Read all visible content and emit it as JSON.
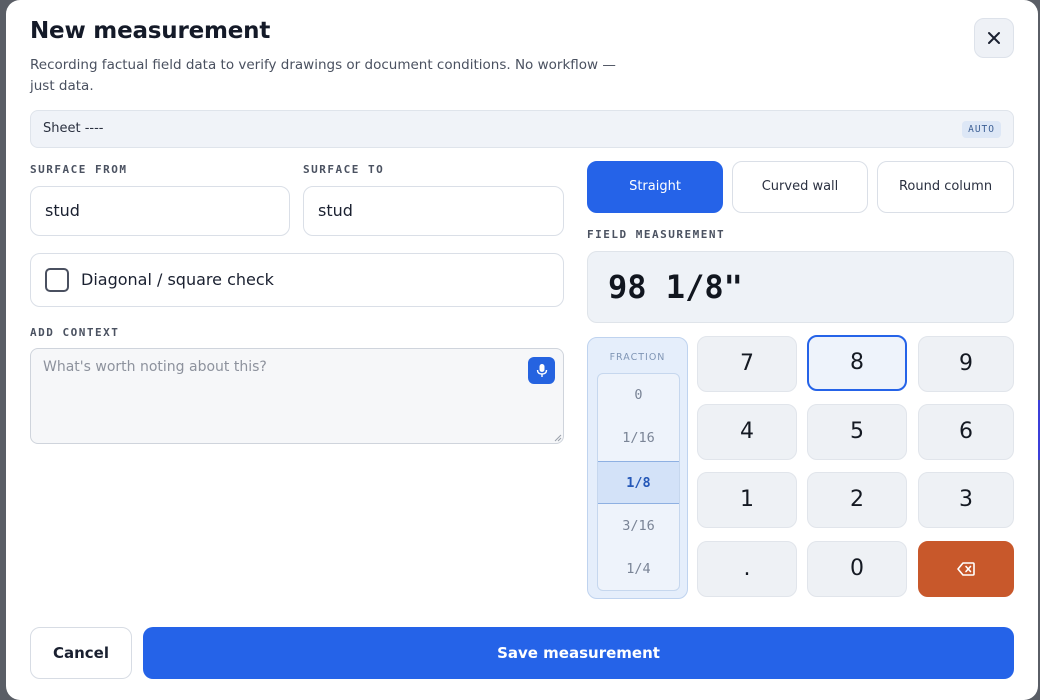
{
  "dialog": {
    "title": "New measurement",
    "subtitle": "Recording factual field data to verify drawings or document conditions. No workflow — just data."
  },
  "sheet": {
    "label": "Sheet ----",
    "badge": "AUTO"
  },
  "surface_from": {
    "label": "SURFACE FROM",
    "value": "stud"
  },
  "surface_to": {
    "label": "SURFACE TO",
    "value": "stud"
  },
  "diagonal_check": {
    "label": "Diagonal / square check",
    "checked": false
  },
  "context": {
    "label": "ADD CONTEXT",
    "placeholder": "What's worth noting about this?"
  },
  "shape_tabs": [
    {
      "label": "Straight",
      "active": true
    },
    {
      "label": "Curved wall",
      "active": false
    },
    {
      "label": "Round column",
      "active": false
    }
  ],
  "measurement": {
    "label": "FIELD MEASUREMENT",
    "value": "98 1/8\""
  },
  "fraction": {
    "title": "FRACTION",
    "options": [
      "0",
      "1/16",
      "1/8",
      "3/16",
      "1/4"
    ],
    "selected": "1/8"
  },
  "keypad": {
    "keys": [
      "7",
      "8",
      "9",
      "4",
      "5",
      "6",
      "1",
      "2",
      "3",
      ".",
      "0"
    ],
    "active_key": "8",
    "backspace_icon": "backspace-icon"
  },
  "footer": {
    "cancel_label": "Cancel",
    "save_label": "Save measurement"
  },
  "colors": {
    "primary": "#2563e8",
    "danger": "#c8582b"
  }
}
